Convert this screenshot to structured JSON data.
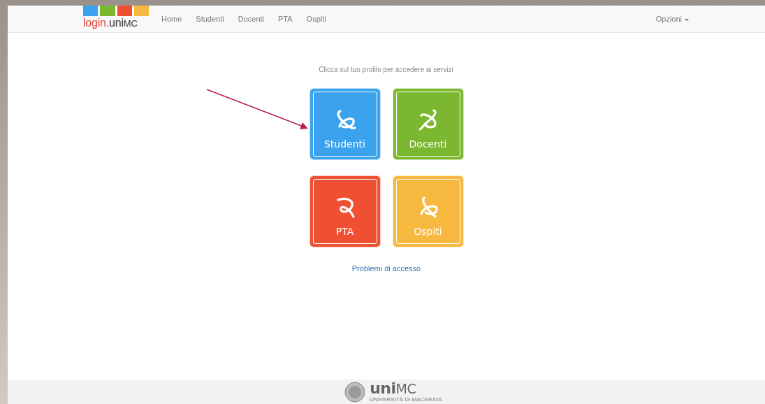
{
  "navbar": {
    "logo": {
      "parts": [
        "login.",
        "uni",
        "MC"
      ]
    },
    "links": [
      {
        "label": "Home"
      },
      {
        "label": "Studenti"
      },
      {
        "label": "Docenti"
      },
      {
        "label": "PTA"
      },
      {
        "label": "Ospiti"
      }
    ],
    "menu": {
      "label": "Opzioni"
    }
  },
  "main": {
    "prompt": "Clicca sul tuo profilo per accedere ai servizi",
    "profiles": [
      {
        "label": "Studenti",
        "color": "#3ba3ee"
      },
      {
        "label": "Docenti",
        "color": "#7cb82f"
      },
      {
        "label": "PTA",
        "color": "#ef5032"
      },
      {
        "label": "Ospiti",
        "color": "#f6b83f"
      }
    ],
    "help_link": "Problemi di accesso"
  },
  "footer": {
    "wordmark": [
      "uni",
      "MC"
    ],
    "subtitle": "UNIVERSITÀ DI MACERATA"
  }
}
